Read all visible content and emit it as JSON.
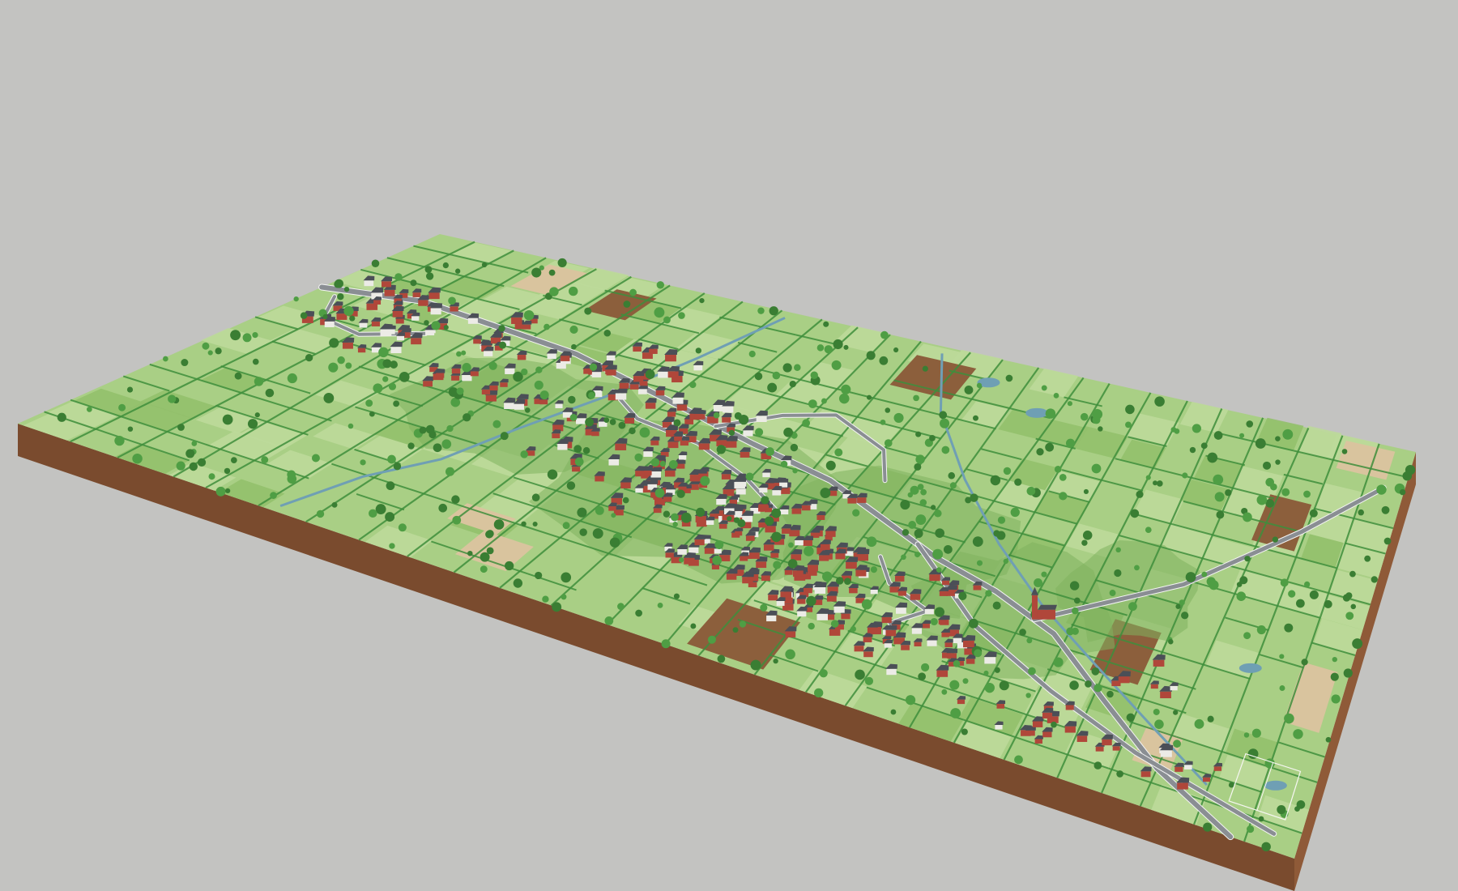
{
  "scene": {
    "kind": "isometric-3d-village-diorama",
    "caption": "",
    "colors": {
      "background": "#c3c3c1",
      "grass": "#a9cf85",
      "grass_light": "#bcd99a",
      "grass_dark": "#92c06c",
      "base_side": "#8f5a38",
      "base_front": "#7a4b2e",
      "hedge": "#3f8f3c",
      "road": "#8a8e93",
      "road_edge": "#f4f4f4",
      "roof": "#4b4f57",
      "wall_brick": "#b0473a",
      "wall_white": "#ecebe6",
      "tree": "#4f9e44",
      "tree_dark": "#3a7e33",
      "plowed_field": "#8c5f3c",
      "sand_field": "#d9c49e",
      "water": "#6f9fb4",
      "woodland": "#7fb35f"
    },
    "features": [
      {
        "name": "village-settlement",
        "icon": "house-cluster-icon"
      },
      {
        "name": "stream",
        "icon": "stream-icon"
      },
      {
        "name": "church",
        "icon": "church-icon"
      },
      {
        "name": "football-pitch",
        "icon": "pitch-icon"
      },
      {
        "name": "ponds",
        "icon": "pond-icon"
      },
      {
        "name": "plowed-fields",
        "icon": "field-icon"
      },
      {
        "name": "main-road",
        "icon": "road-icon"
      }
    ]
  }
}
